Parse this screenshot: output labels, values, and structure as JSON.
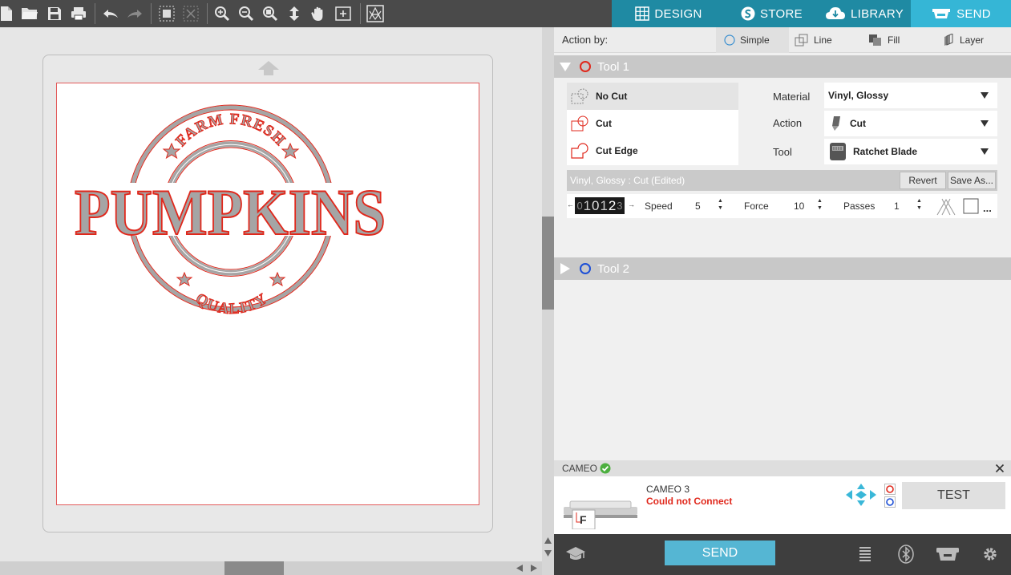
{
  "nav": {
    "tabs": [
      {
        "label": "DESIGN"
      },
      {
        "label": "STORE"
      },
      {
        "label": "LIBRARY"
      },
      {
        "label": "SEND"
      }
    ]
  },
  "design": {
    "top_text": "FARM FRESH",
    "main_text": "PUMPKINS",
    "bottom_text": "QUALITY"
  },
  "panel": {
    "action_by_label": "Action by:",
    "action_options": [
      {
        "label": "Simple"
      },
      {
        "label": "Line"
      },
      {
        "label": "Fill"
      },
      {
        "label": "Layer"
      }
    ],
    "tool1": {
      "label": "Tool 1",
      "color": "#e0281c",
      "cut_options": [
        {
          "label": "No Cut"
        },
        {
          "label": "Cut"
        },
        {
          "label": "Cut Edge"
        }
      ],
      "material_label": "Material",
      "material_value": "Vinyl, Glossy",
      "action_label": "Action",
      "action_value": "Cut",
      "tool_label": "Tool",
      "tool_value": "Ratchet Blade",
      "edit_label": "Vinyl, Glossy : Cut (Edited)",
      "revert_label": "Revert",
      "save_as_label": "Save As...",
      "blade_digits": [
        "0",
        "1",
        "0",
        "1",
        "2",
        "3"
      ],
      "speed_label": "Speed",
      "speed_value": "5",
      "force_label": "Force",
      "force_value": "10",
      "passes_label": "Passes",
      "passes_value": "1",
      "more_label": "..."
    },
    "tool2": {
      "label": "Tool 2",
      "color": "#1d4fd6"
    }
  },
  "cameo": {
    "header_label": "CAMEO",
    "device_name": "CAMEO 3",
    "status": "Could not Connect",
    "status_color": "#e0281c",
    "thumb_letter": "F",
    "test_label": "TEST"
  },
  "bottom": {
    "send_label": "SEND"
  },
  "colors": {
    "accent": "#1f8aa3",
    "accent_active": "#35b6d6",
    "design_fill": "#a5a5a5",
    "design_stroke": "#e0281c"
  }
}
